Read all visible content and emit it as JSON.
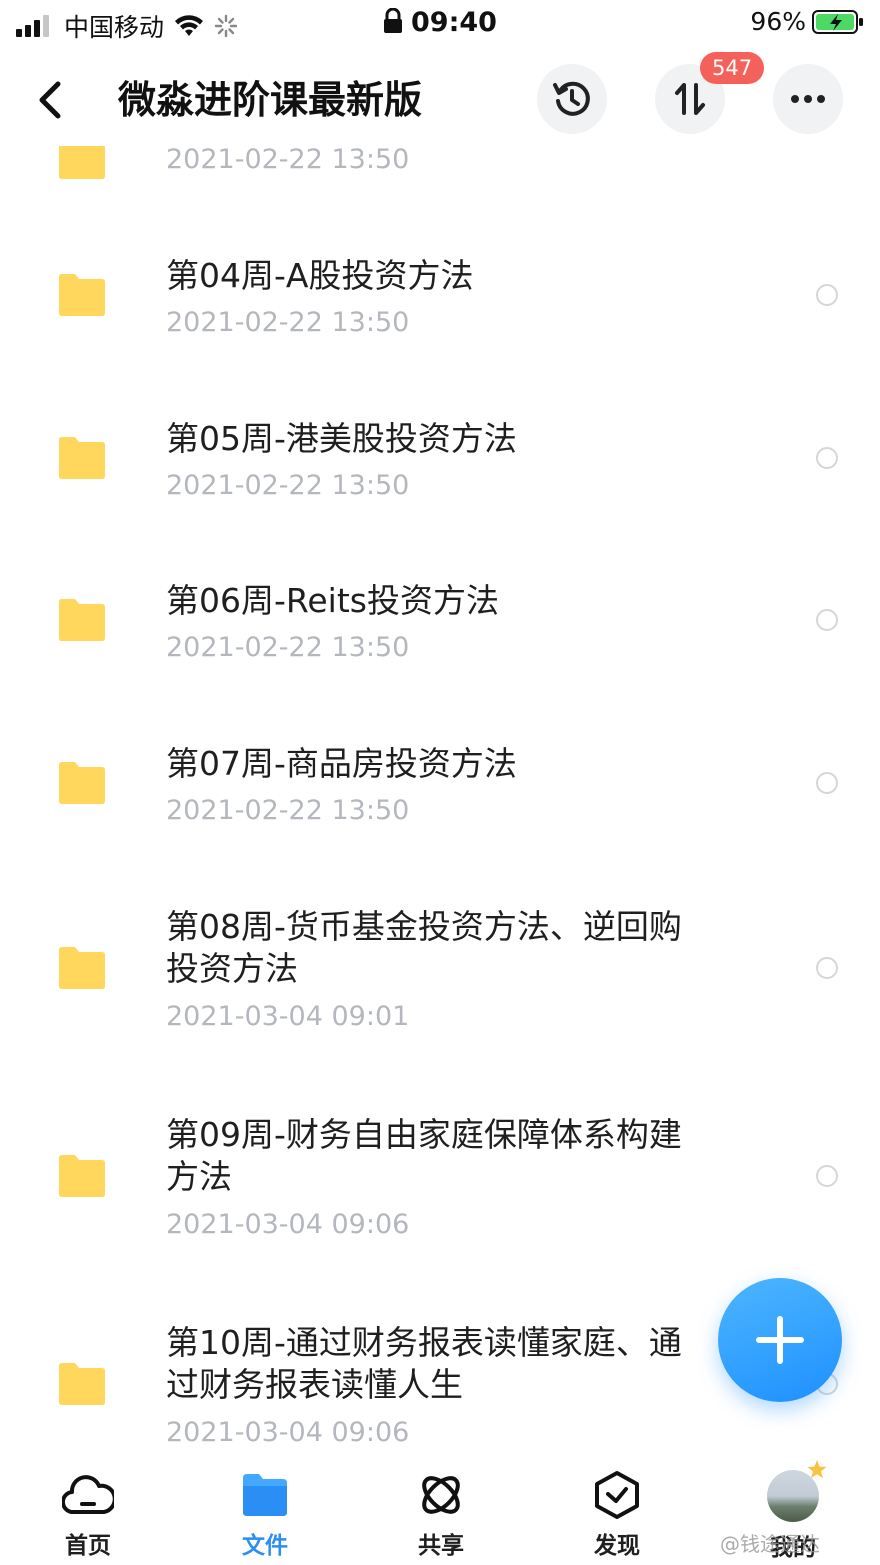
{
  "status_bar": {
    "carrier": "中国移动",
    "time": "09:40",
    "battery": "96%"
  },
  "header": {
    "title": "微淼进阶课最新版",
    "transfer_badge": "547"
  },
  "files": [
    {
      "name": "",
      "date": "2021-02-22 13:50"
    },
    {
      "name": "第04周-A股投资方法",
      "date": "2021-02-22 13:50"
    },
    {
      "name": "第05周-港美股投资方法",
      "date": "2021-02-22 13:50"
    },
    {
      "name": "第06周-Reits投资方法",
      "date": "2021-02-22 13:50"
    },
    {
      "name": "第07周-商品房投资方法",
      "date": "2021-02-22 13:50"
    },
    {
      "name": "第08周-货币基金投资方法、逆回购投资方法",
      "date": "2021-03-04 09:01"
    },
    {
      "name": "第09周-财务自由家庭保障体系构建方法",
      "date": "2021-03-04 09:06"
    },
    {
      "name": "第10周-通过财务报表读懂家庭、通过财务报表读懂人生",
      "date": "2021-03-04 09:06"
    }
  ],
  "tabbar": {
    "items": [
      {
        "label": "首页"
      },
      {
        "label": "文件"
      },
      {
        "label": "共享"
      },
      {
        "label": "发现"
      },
      {
        "label": "我的"
      }
    ],
    "active_color": "#2b8ef5"
  },
  "folder_color": "#ffd75c",
  "watermark": "@钱途通达"
}
